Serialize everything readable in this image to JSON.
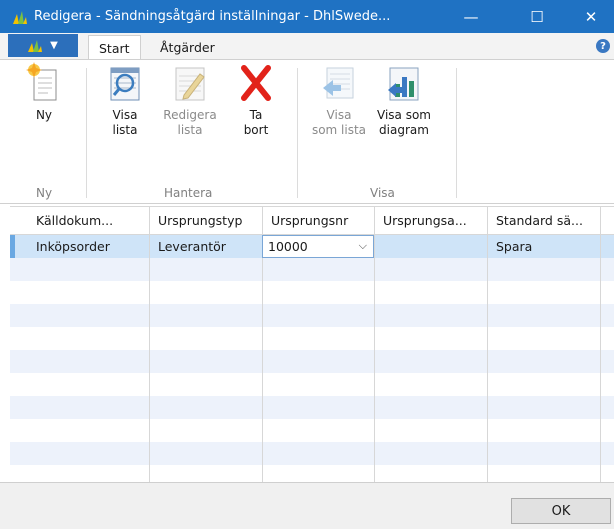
{
  "window": {
    "title": "Redigera - Sändningsåtgärd inställningar - DhlSwede...",
    "minimize": "—",
    "maximize": "☐",
    "close": "✕",
    "accent": "#1f72c3"
  },
  "ribbon_tabs": [
    "Start",
    "Åtgärder"
  ],
  "ribbon": {
    "buttons": [
      {
        "line1": "Ny",
        "line2": "",
        "icon": "new-document-icon"
      },
      {
        "line1": "Visa",
        "line2": "lista",
        "icon": "view-list-icon"
      },
      {
        "line1": "Redigera",
        "line2": "lista",
        "icon": "edit-list-icon"
      },
      {
        "line1": "Ta",
        "line2": "bort",
        "icon": "delete-icon"
      },
      {
        "line1": "Visa",
        "line2": "som lista",
        "icon": "show-as-list-icon"
      },
      {
        "line1": "Visa som",
        "line2": "diagram",
        "icon": "show-as-chart-icon"
      }
    ],
    "groups": [
      "Ny",
      "Hantera",
      "Visa"
    ]
  },
  "grid": {
    "columns": [
      "Källdokum...",
      "Ursprungstyp",
      "Ursprungsnr",
      "Ursprungsa...",
      "Standard sä..."
    ],
    "rows": [
      [
        "Inköpsorder",
        "Leverantör",
        "10000",
        "",
        "Spara"
      ]
    ],
    "empty_rows": 10
  },
  "footer": {
    "ok": "OK"
  }
}
